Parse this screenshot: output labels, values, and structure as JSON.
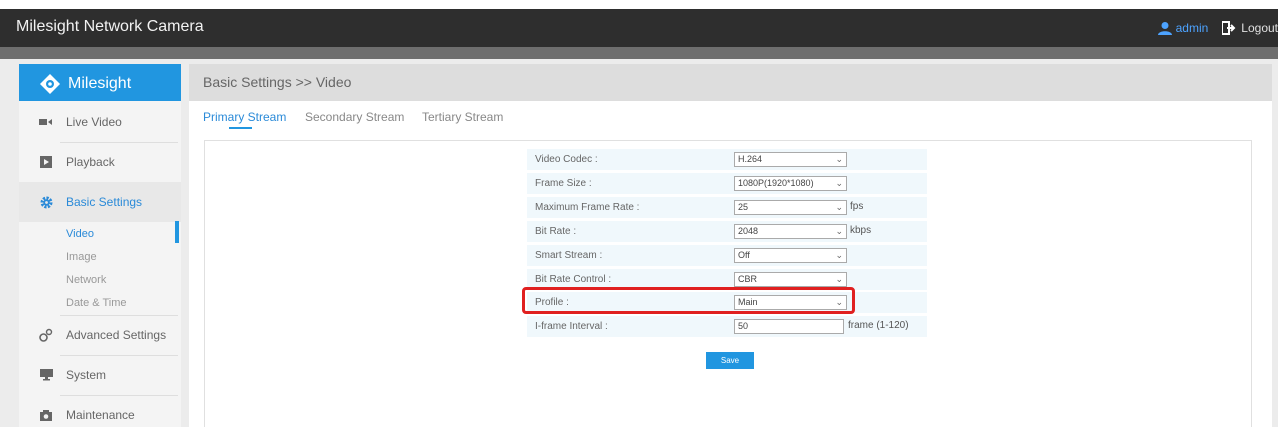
{
  "app": {
    "title": "Milesight Network Camera",
    "user": "admin",
    "logout": "Logout"
  },
  "sidebar": {
    "brand": "Milesight",
    "items": [
      {
        "label": "Live Video",
        "icon": "video-camera-icon"
      },
      {
        "label": "Playback",
        "icon": "playback-icon"
      },
      {
        "label": "Basic Settings",
        "icon": "gear-icon"
      },
      {
        "label": "Advanced Settings",
        "icon": "gears-icon"
      },
      {
        "label": "System",
        "icon": "monitor-icon"
      },
      {
        "label": "Maintenance",
        "icon": "camera-icon"
      }
    ],
    "subitems": [
      "Video",
      "Image",
      "Network",
      "Date & Time"
    ]
  },
  "header": {
    "breadcrumb": "Basic Settings >> Video"
  },
  "tabs": [
    "Primary Stream",
    "Secondary Stream",
    "Tertiary Stream"
  ],
  "form": {
    "video_codec": {
      "label": "Video Codec :",
      "value": "H.264"
    },
    "frame_size": {
      "label": "Frame Size :",
      "value": "1080P(1920*1080)"
    },
    "max_frame_rate": {
      "label": "Maximum Frame Rate :",
      "value": "25",
      "unit": "fps"
    },
    "bit_rate": {
      "label": "Bit Rate :",
      "value": "2048",
      "unit": "kbps"
    },
    "smart_stream": {
      "label": "Smart Stream :",
      "value": "Off"
    },
    "bit_rate_control": {
      "label": "Bit Rate Control :",
      "value": "CBR"
    },
    "profile": {
      "label": "Profile :",
      "value": "Main"
    },
    "iframe_interval": {
      "label": "I-frame Interval :",
      "value": "50",
      "unit": "frame (1-120)"
    }
  },
  "save_label": "Save",
  "colors": {
    "accent": "#2196e0",
    "highlight": "#e02020",
    "topbar": "#2e2e2e"
  }
}
